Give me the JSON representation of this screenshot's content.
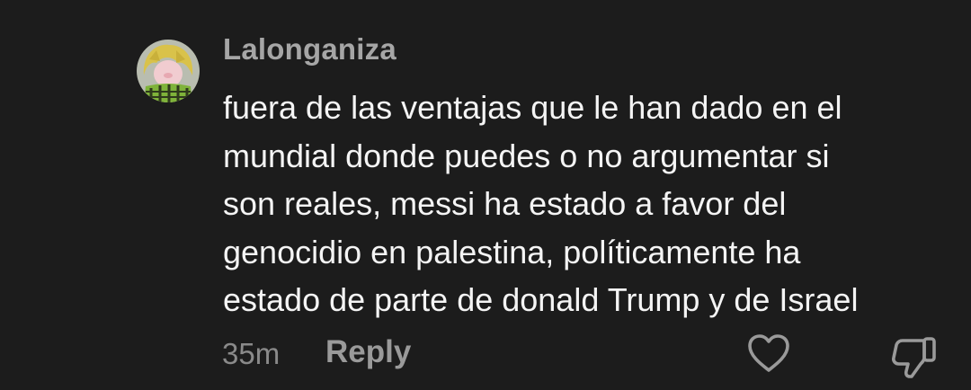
{
  "comment": {
    "username": "Lalonganiza",
    "avatar_icon": "anime-character-avatar",
    "text_lines": [
      "fuera de las ventajas que le han dado en el",
      "mundial donde puedes o no argumentar si",
      "son reales, messi ha estado a favor del",
      "genocidio en palestina, políticamente ha",
      "estado de parte de donald Trump y de Israel"
    ],
    "timestamp": "35m",
    "reply_label": "Reply",
    "like_icon": "heart-outline-icon",
    "dislike_icon": "thumbs-down-icon"
  },
  "colors": {
    "background": "#1c1c1c",
    "username": "#a6a6a6",
    "text": "#f4f4f4",
    "meta": "#8a8a8a",
    "icons": "#9a9a9a"
  }
}
